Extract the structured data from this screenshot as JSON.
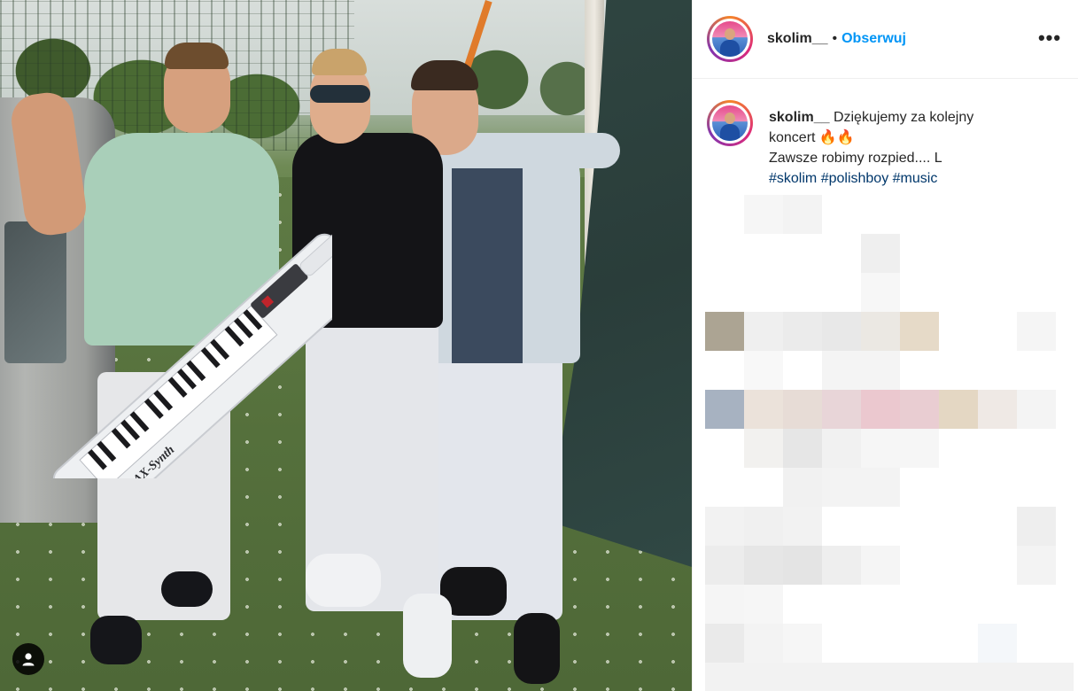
{
  "post": {
    "username": "skolim__",
    "separator": "•",
    "follow_label": "Obserwuj",
    "more_label": "•••",
    "caption": {
      "username": "skolim__",
      "line1": "Dziękujemy za kolejny",
      "line2": "koncert",
      "emoji": "🔥🔥",
      "line3": "Zawsze robimy rozpied.... L",
      "hashtags": [
        "#skolim",
        "#polishboy",
        "#music"
      ]
    }
  },
  "photo": {
    "keytar_brand": "AX-Synth"
  },
  "colors": {
    "accent": "#0095f6",
    "hashtag": "#00376b",
    "text": "#262626"
  }
}
